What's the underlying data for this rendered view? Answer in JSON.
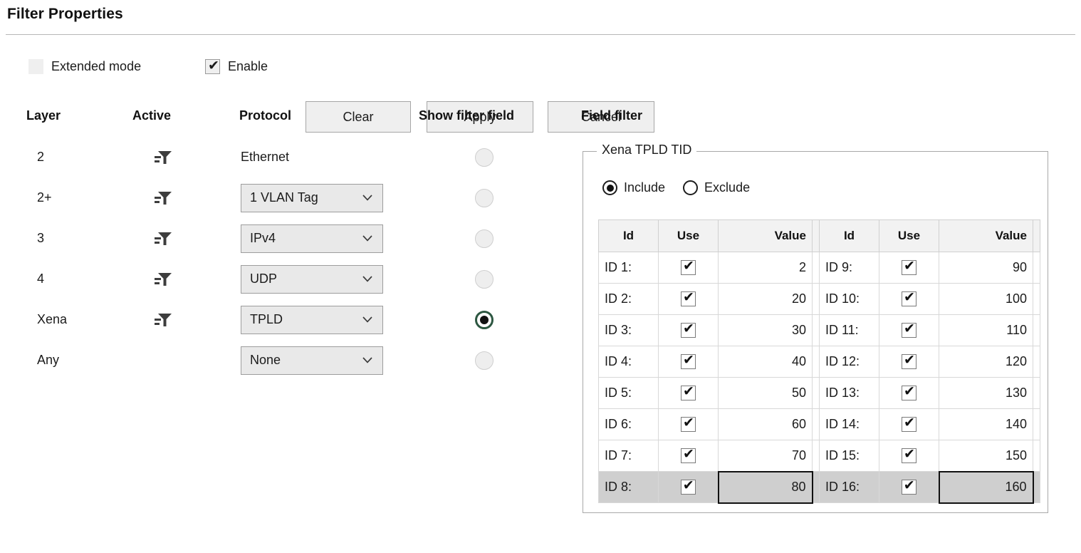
{
  "page": {
    "title": "Filter Properties"
  },
  "toolbar": {
    "extended_mode": {
      "label": "Extended mode",
      "checked": false
    },
    "enable": {
      "label": "Enable",
      "checked": true,
      "check_glyph": "✔"
    },
    "clear_label": "Clear",
    "apply_label": "Apply",
    "cancel_label": "Cancel"
  },
  "columns": {
    "layer": "Layer",
    "active": "Active",
    "protocol": "Protocol",
    "show_filter_field": "Show filter field",
    "field_filter": "Field filter"
  },
  "rows": [
    {
      "layer": "2",
      "has_active": true,
      "protocol": "Ethernet",
      "is_select": false,
      "show_selected": false
    },
    {
      "layer": "2+",
      "has_active": true,
      "protocol": "1 VLAN Tag",
      "is_select": true,
      "show_selected": false
    },
    {
      "layer": "3",
      "has_active": true,
      "protocol": "IPv4",
      "is_select": true,
      "show_selected": false
    },
    {
      "layer": "4",
      "has_active": true,
      "protocol": "UDP",
      "is_select": true,
      "show_selected": false
    },
    {
      "layer": "Xena",
      "has_active": true,
      "protocol": "TPLD",
      "is_select": true,
      "show_selected": true
    },
    {
      "layer": "Any",
      "has_active": false,
      "protocol": "None",
      "is_select": true,
      "show_selected": false
    }
  ],
  "field_filter": {
    "group_title": "Xena TPLD TID",
    "mode": {
      "include_label": "Include",
      "exclude_label": "Exclude",
      "selected": "Include"
    },
    "table_headers": {
      "id": "Id",
      "use": "Use",
      "value": "Value"
    },
    "check_glyph": "✔",
    "left_table": [
      {
        "id": "ID 1:",
        "use": true,
        "value": "2",
        "selected": false,
        "editing": false
      },
      {
        "id": "ID 2:",
        "use": true,
        "value": "20",
        "selected": false,
        "editing": false
      },
      {
        "id": "ID 3:",
        "use": true,
        "value": "30",
        "selected": false,
        "editing": false
      },
      {
        "id": "ID 4:",
        "use": true,
        "value": "40",
        "selected": false,
        "editing": false
      },
      {
        "id": "ID 5:",
        "use": true,
        "value": "50",
        "selected": false,
        "editing": false
      },
      {
        "id": "ID 6:",
        "use": true,
        "value": "60",
        "selected": false,
        "editing": false
      },
      {
        "id": "ID 7:",
        "use": true,
        "value": "70",
        "selected": false,
        "editing": false
      },
      {
        "id": "ID 8:",
        "use": true,
        "value": "80",
        "selected": true,
        "editing": true
      }
    ],
    "right_table": [
      {
        "id": "ID 9:",
        "use": true,
        "value": "90",
        "selected": false,
        "editing": false
      },
      {
        "id": "ID 10:",
        "use": true,
        "value": "100",
        "selected": false,
        "editing": false
      },
      {
        "id": "ID 11:",
        "use": true,
        "value": "110",
        "selected": false,
        "editing": false
      },
      {
        "id": "ID 12:",
        "use": true,
        "value": "120",
        "selected": false,
        "editing": false
      },
      {
        "id": "ID 13:",
        "use": true,
        "value": "130",
        "selected": false,
        "editing": false
      },
      {
        "id": "ID 14:",
        "use": true,
        "value": "140",
        "selected": false,
        "editing": false
      },
      {
        "id": "ID 15:",
        "use": true,
        "value": "150",
        "selected": false,
        "editing": false
      },
      {
        "id": "ID 16:",
        "use": true,
        "value": "160",
        "selected": true,
        "editing": true
      }
    ]
  },
  "icons": {
    "funnel": "filter-funnel-icon",
    "chevron": "chevron-down-icon"
  },
  "colors": {
    "accent_radio_ring": "#2d5741",
    "button_face": "#efefef",
    "select_face": "#e9e9e9",
    "selected_row": "#cfcfcf",
    "header_face": "#f2f2f2"
  }
}
